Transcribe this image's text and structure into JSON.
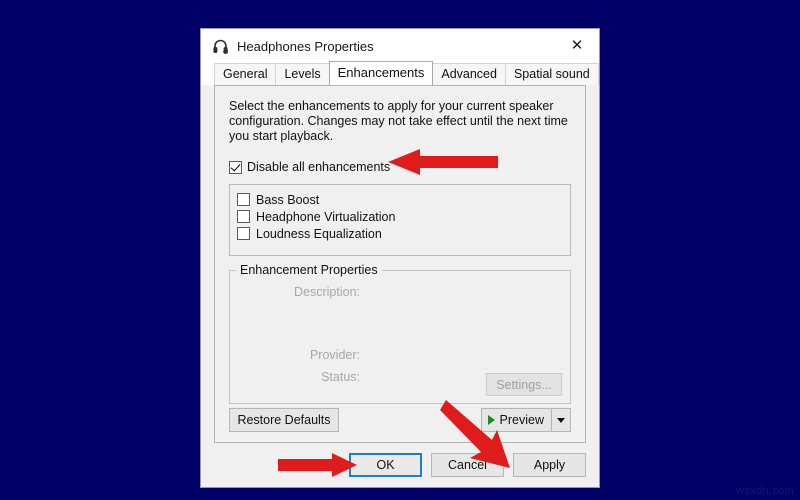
{
  "window": {
    "title": "Headphones Properties",
    "icon": "headphones-icon",
    "close_label": "✕"
  },
  "tabs": [
    {
      "label": "General",
      "active": false
    },
    {
      "label": "Levels",
      "active": false
    },
    {
      "label": "Enhancements",
      "active": true
    },
    {
      "label": "Advanced",
      "active": false
    },
    {
      "label": "Spatial sound",
      "active": false
    }
  ],
  "enhancements_tab": {
    "intro_text": "Select the enhancements to apply for your current speaker configuration. Changes may not take effect until the next time you start playback.",
    "disable_all": {
      "label": "Disable all enhancements",
      "checked": true
    },
    "enhancement_list": [
      {
        "label": "Bass Boost",
        "checked": false
      },
      {
        "label": "Headphone Virtualization",
        "checked": false
      },
      {
        "label": "Loudness Equalization",
        "checked": false
      }
    ],
    "properties_group": {
      "title": "Enhancement Properties",
      "description_label": "Description:",
      "description_value": "",
      "provider_label": "Provider:",
      "provider_value": "",
      "status_label": "Status:",
      "status_value": "",
      "settings_button": "Settings...",
      "settings_enabled": false
    },
    "restore_defaults_button": "Restore Defaults",
    "preview_button": "Preview"
  },
  "footer_buttons": [
    {
      "label": "OK",
      "default": true
    },
    {
      "label": "Cancel",
      "default": false
    },
    {
      "label": "Apply",
      "default": false
    }
  ],
  "annotations": [
    {
      "name": "arrow-to-disable-all-checkbox",
      "direction": "left",
      "color": "#e01b1b"
    },
    {
      "name": "arrow-to-apply-button",
      "direction": "down-right",
      "color": "#e01b1b"
    },
    {
      "name": "arrow-to-ok-button",
      "direction": "right",
      "color": "#e01b1b"
    }
  ],
  "watermark": "wsxdn.com",
  "colors": {
    "desktop_background": "#000066",
    "dialog_face": "#f0f0f0",
    "accent_focus": "#1f7fc4",
    "annotation_red": "#e01b1b",
    "play_green": "#1f8a1f"
  }
}
